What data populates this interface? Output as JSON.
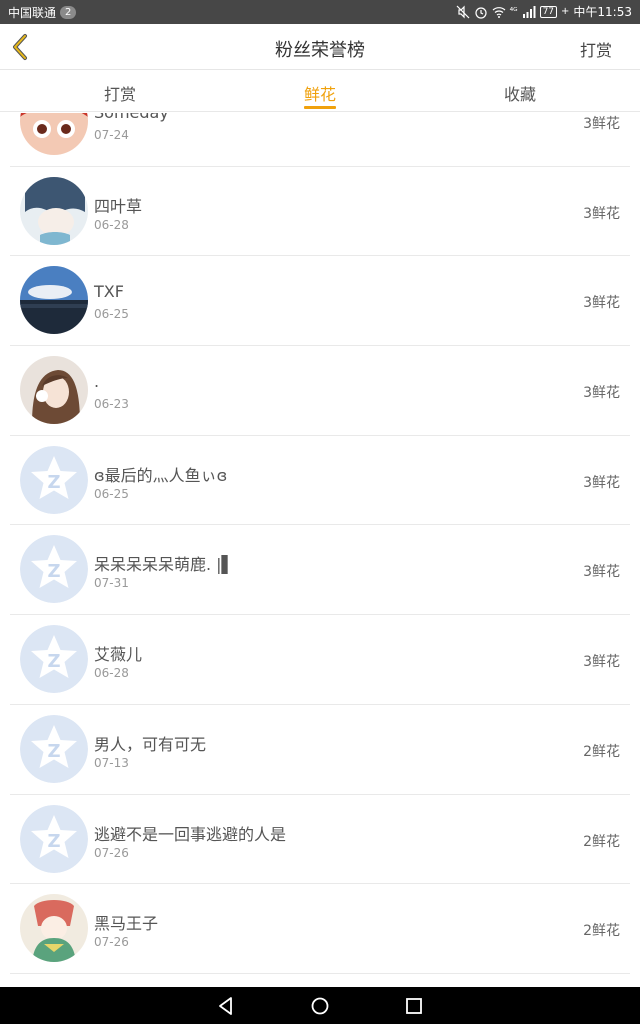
{
  "status_bar": {
    "carrier": "中国联通",
    "notification_count": "2",
    "signal": "⁴ᴳ",
    "battery": "77",
    "time": "中午11:53"
  },
  "header": {
    "title": "粉丝荣誉榜",
    "action": "打赏"
  },
  "tabs": [
    {
      "label": "打赏",
      "active": false
    },
    {
      "label": "鲜花",
      "active": true
    },
    {
      "label": "收藏",
      "active": false
    }
  ],
  "fans": [
    {
      "name": "Someday",
      "date": "07-24",
      "count": "3鲜花",
      "avatar": "anime-red"
    },
    {
      "name": "四叶草",
      "date": "06-28",
      "count": "3鲜花",
      "avatar": "anime-blue"
    },
    {
      "name": "TXF",
      "date": "06-25",
      "count": "3鲜花",
      "avatar": "landscape"
    },
    {
      "name": ".",
      "date": "06-23",
      "count": "3鲜花",
      "avatar": "portrait"
    },
    {
      "name": "ɞ最后的灬人鱼ぃɞ",
      "date": "06-25",
      "count": "3鲜花",
      "avatar": "default"
    },
    {
      "name": "呆呆呆呆呆萌鹿. |▌",
      "date": "07-31",
      "count": "3鲜花",
      "avatar": "default"
    },
    {
      "name": "艾薇儿",
      "date": "06-28",
      "count": "3鲜花",
      "avatar": "default"
    },
    {
      "name": "男人，可有可无",
      "date": "07-13",
      "count": "2鲜花",
      "avatar": "default"
    },
    {
      "name": "逃避不是一回事逃避的人是",
      "date": "07-26",
      "count": "2鲜花",
      "avatar": "default"
    },
    {
      "name": "黑马王子",
      "date": "07-26",
      "count": "2鲜花",
      "avatar": "anime-green"
    }
  ],
  "colors": {
    "accent": "#f0a10c",
    "status_bar": "#474747",
    "default_avatar": "#dce6f4"
  }
}
